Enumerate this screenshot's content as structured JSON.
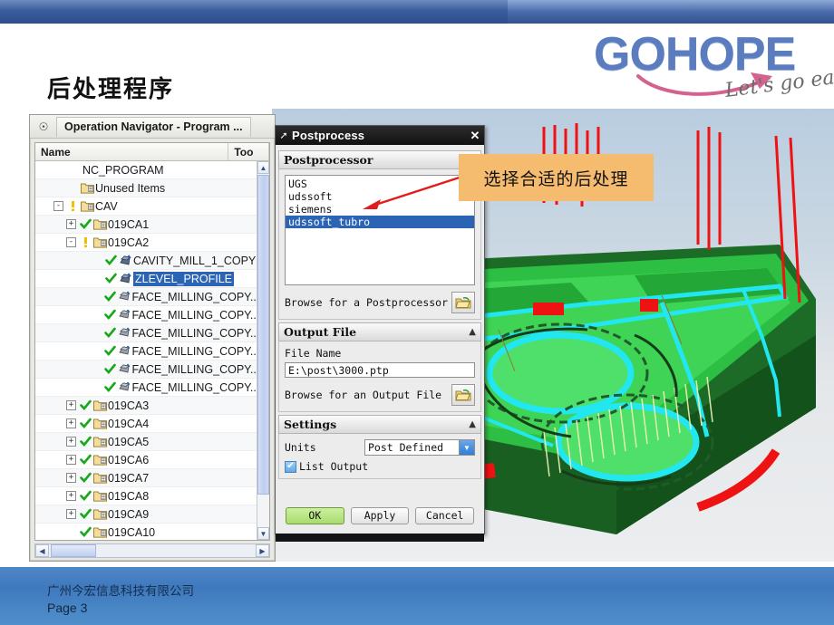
{
  "slide": {
    "title": "后处理程序",
    "footer_company": "广州今宏信息科技有限公司",
    "footer_page": "Page 3"
  },
  "logo": {
    "wordmark": "GOHOPE",
    "tagline": "Let's go easy!",
    "color": "#5b7cbe",
    "arrow_color": "#d4628f"
  },
  "navigator": {
    "title": "Operation Navigator - Program ...",
    "title_icon": "navigator-icon",
    "columns": [
      "Name",
      "Too"
    ],
    "rows": [
      {
        "label": "NC_PROGRAM",
        "indent": 0,
        "toggle": "",
        "mark": "",
        "icon": ""
      },
      {
        "label": "Unused Items",
        "indent": 1,
        "toggle": "",
        "mark": "",
        "icon": "program-folder"
      },
      {
        "label": "CAV",
        "indent": 1,
        "toggle": "-",
        "mark": "warn",
        "icon": "program-folder"
      },
      {
        "label": "019CA1",
        "indent": 2,
        "toggle": "+",
        "mark": "ok",
        "icon": "program-folder"
      },
      {
        "label": "019CA2",
        "indent": 2,
        "toggle": "-",
        "mark": "warn",
        "icon": "program-folder"
      },
      {
        "label": "CAVITY_MILL_1_COPY",
        "indent": 4,
        "toggle": "",
        "mark": "ok",
        "icon": "cavity-mill"
      },
      {
        "label": "ZLEVEL_PROFILE",
        "indent": 4,
        "toggle": "",
        "mark": "ok",
        "icon": "zlevel-profile",
        "selected": true
      },
      {
        "label": "FACE_MILLING_COPY...",
        "indent": 4,
        "toggle": "",
        "mark": "ok",
        "icon": "face-milling"
      },
      {
        "label": "FACE_MILLING_COPY...",
        "indent": 4,
        "toggle": "",
        "mark": "ok",
        "icon": "face-milling"
      },
      {
        "label": "FACE_MILLING_COPY...",
        "indent": 4,
        "toggle": "",
        "mark": "ok",
        "icon": "face-milling"
      },
      {
        "label": "FACE_MILLING_COPY...",
        "indent": 4,
        "toggle": "",
        "mark": "ok",
        "icon": "face-milling"
      },
      {
        "label": "FACE_MILLING_COPY...",
        "indent": 4,
        "toggle": "",
        "mark": "ok",
        "icon": "face-milling"
      },
      {
        "label": "FACE_MILLING_COPY...",
        "indent": 4,
        "toggle": "",
        "mark": "ok",
        "icon": "face-milling"
      },
      {
        "label": "019CA3",
        "indent": 2,
        "toggle": "+",
        "mark": "ok",
        "icon": "program-folder"
      },
      {
        "label": "019CA4",
        "indent": 2,
        "toggle": "+",
        "mark": "ok",
        "icon": "program-folder"
      },
      {
        "label": "019CA5",
        "indent": 2,
        "toggle": "+",
        "mark": "ok",
        "icon": "program-folder"
      },
      {
        "label": "019CA6",
        "indent": 2,
        "toggle": "+",
        "mark": "ok",
        "icon": "program-folder"
      },
      {
        "label": "019CA7",
        "indent": 2,
        "toggle": "+",
        "mark": "ok",
        "icon": "program-folder"
      },
      {
        "label": "019CA8",
        "indent": 2,
        "toggle": "+",
        "mark": "ok",
        "icon": "program-folder"
      },
      {
        "label": "019CA9",
        "indent": 2,
        "toggle": "+",
        "mark": "ok",
        "icon": "program-folder"
      },
      {
        "label": "019CA10",
        "indent": 2,
        "toggle": "",
        "mark": "ok",
        "icon": "program-folder"
      }
    ]
  },
  "dialog": {
    "title": "Postprocess",
    "close_label": "✕",
    "groups": {
      "postprocessor": {
        "header": "Postprocessor",
        "collapse_glyph": "▲",
        "items": [
          "UGS",
          "udssoft",
          "siemens",
          "udssoft_tubro"
        ],
        "selected_item": "udssoft_tubro",
        "browse_label": "Browse for a Postprocessor"
      },
      "output_file": {
        "header": "Output File",
        "collapse_glyph": "▲",
        "file_name_label": "File Name",
        "file_name_value": "E:\\post\\3000.ptp",
        "browse_label": "Browse for an Output File"
      },
      "settings": {
        "header": "Settings",
        "collapse_glyph": "▲",
        "units_label": "Units",
        "units_value": "Post Defined",
        "list_output_label": "List Output",
        "list_output_checked": "✔"
      }
    },
    "buttons": {
      "ok": "OK",
      "apply": "Apply",
      "cancel": "Cancel"
    }
  },
  "annotation": {
    "text": "选择合适的后处理",
    "background": "#f5bc70",
    "arrow_color": "#e21b1b"
  }
}
